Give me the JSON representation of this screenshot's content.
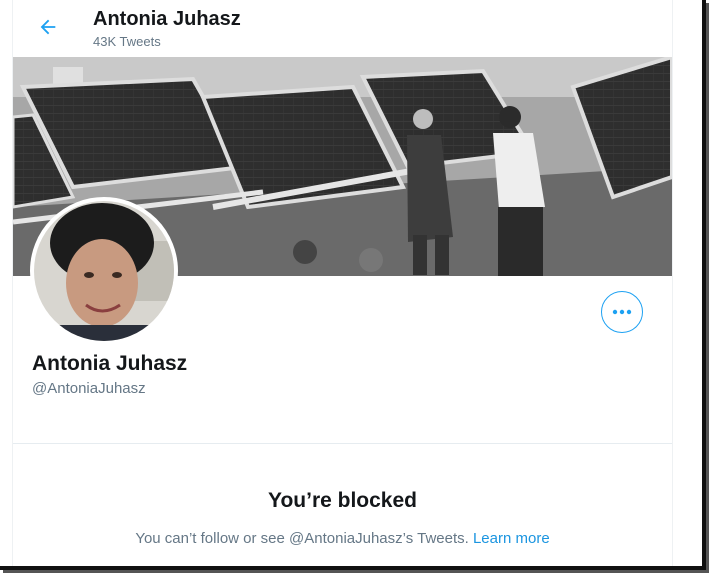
{
  "header": {
    "title": "Antonia Juhasz",
    "subtitle": "43K Tweets",
    "back_icon": "arrow-left-icon"
  },
  "banner": {
    "description_icon": "header-photo"
  },
  "profile": {
    "name": "Antonia Juhasz",
    "handle": "@AntoniaJuhasz",
    "more_icon": "more-horizontal-icon"
  },
  "blocked": {
    "title": "You’re blocked",
    "message": "You can’t follow or see @AntoniaJuhasz’s Tweets.",
    "link_label": "Learn more"
  },
  "colors": {
    "accent": "#1da1f2",
    "link": "#1b95e0",
    "text_primary": "#14171a",
    "text_secondary": "#657786"
  }
}
